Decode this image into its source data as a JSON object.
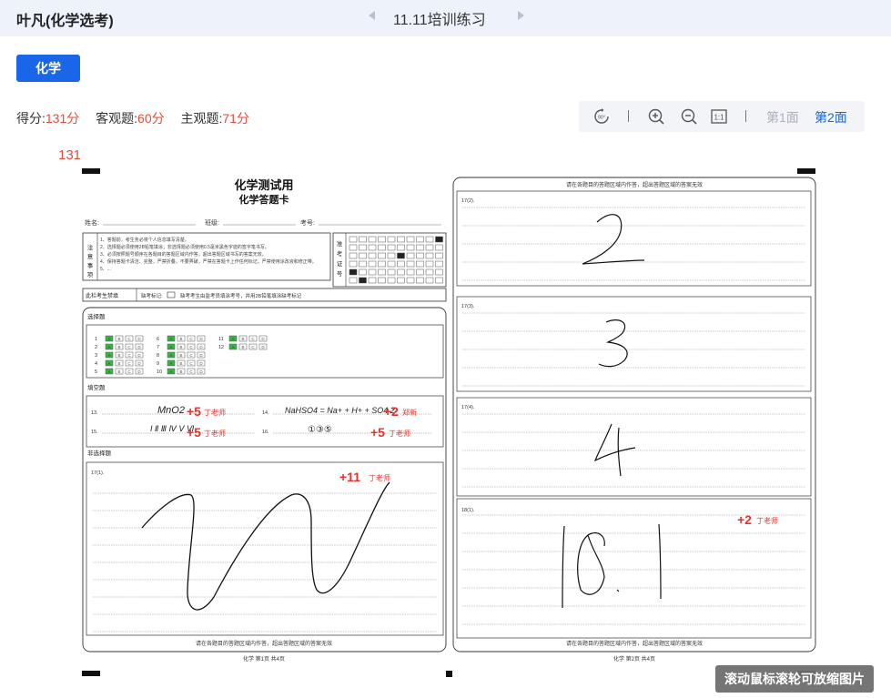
{
  "header": {
    "student_name": "叶凡(化学选考)",
    "exam_title": "11.11培训练习"
  },
  "subject_button": "化学",
  "score_summary": {
    "total_label": "得分:",
    "total_value": "131分",
    "objective_label": "客观题:",
    "objective_value": "60分",
    "subjective_label": "主观题:",
    "subjective_value": "71分"
  },
  "toolbar": {
    "icons": [
      "rotate-90-icon",
      "zoom-in-icon",
      "zoom-out-icon",
      "actual-size-1to1-icon"
    ],
    "page_1": "第1面",
    "page_2": "第2面",
    "active_page": "第2面"
  },
  "total_overlay": "131",
  "zoom_tip": "滚动鼠标滚轮可放缩图片",
  "answer_sheet": {
    "left_page": {
      "title": "化学测试用",
      "subtitle": "化学答题卡",
      "name_label": "姓名:",
      "school_label": "班级:",
      "exam_no_label": "考号:",
      "notice_label": "注意事项",
      "notice_lines": [
        "1、答题前，考生务必将个人信息填写清楚。",
        "2、选择题必须使用2B铅笔填涂；非选择题必须使用0.5毫米黑色字迹的签字笔书写。",
        "3、必须按照题号顺序在各题目的答题区域内作答，超出答题区域书写的答案无效。",
        "4、保持答题卡清洁、完整，严禁折叠，不要弄破，严禁在答题卡上作任何标记，严禁使用涂改液和修正带。",
        "5、..."
      ],
      "admission_label": "准考证号",
      "missing_label": "此栏考生禁填",
      "missing_mark_label": "缺考标记:",
      "missing_note": "缺考考生由监考员填涂考号，并用2B铅笔填涂缺考标记",
      "mc_section": "选择题",
      "mc_questions": [
        "1",
        "2",
        "3",
        "4",
        "5",
        "6",
        "7",
        "8",
        "9",
        "10",
        "11",
        "12"
      ],
      "mc_options": [
        "A",
        "B",
        "C",
        "D"
      ],
      "fill_section": "填空题",
      "fill_numbers": [
        "13.",
        "14.",
        "15.",
        "16."
      ],
      "fill_handwriting": [
        "MnO2",
        "NaHSO4 = Na+ + H+ + SO4 2-",
        "I Ⅱ Ⅲ Ⅳ Ⅴ Ⅵ",
        "①③⑤"
      ],
      "nonmc_section": "非选择题",
      "q17_label": "17(1).",
      "q17_handwriting": "W",
      "footer_note": "请在各题目的答题区域内作答，超出答题区域的答案无效",
      "page_footer": "化学     第1页  共4页"
    },
    "right_page": {
      "header_note": "请在各题目的答题区域内作答，超出答题区域的答案无效",
      "boxes": [
        {
          "label": "17(2).",
          "handwriting": "2"
        },
        {
          "label": "17(3).",
          "handwriting": "3"
        },
        {
          "label": "17(4).",
          "handwriting": "4"
        },
        {
          "label": "18(1).",
          "handwriting": "18.1"
        }
      ],
      "footer_note": "请在各题目的答题区域内作答，超出答题区域的答案无效",
      "page_footer": "化学     第2页  共4页"
    },
    "score_marks": [
      {
        "points": "+5",
        "teacher": "丁老师"
      },
      {
        "points": "+2",
        "teacher": "郑新"
      },
      {
        "points": "+5",
        "teacher": "丁老师"
      },
      {
        "points": "+5",
        "teacher": "丁老师"
      },
      {
        "points": "+11",
        "teacher": "丁老师"
      },
      {
        "points": "+2",
        "teacher": "丁老师"
      }
    ]
  },
  "colors": {
    "accent_blue": "#1a66e8",
    "score_red": "#e34d3b",
    "header_bg": "#eef3fb",
    "filled_bubble_green": "#3bb54a"
  }
}
